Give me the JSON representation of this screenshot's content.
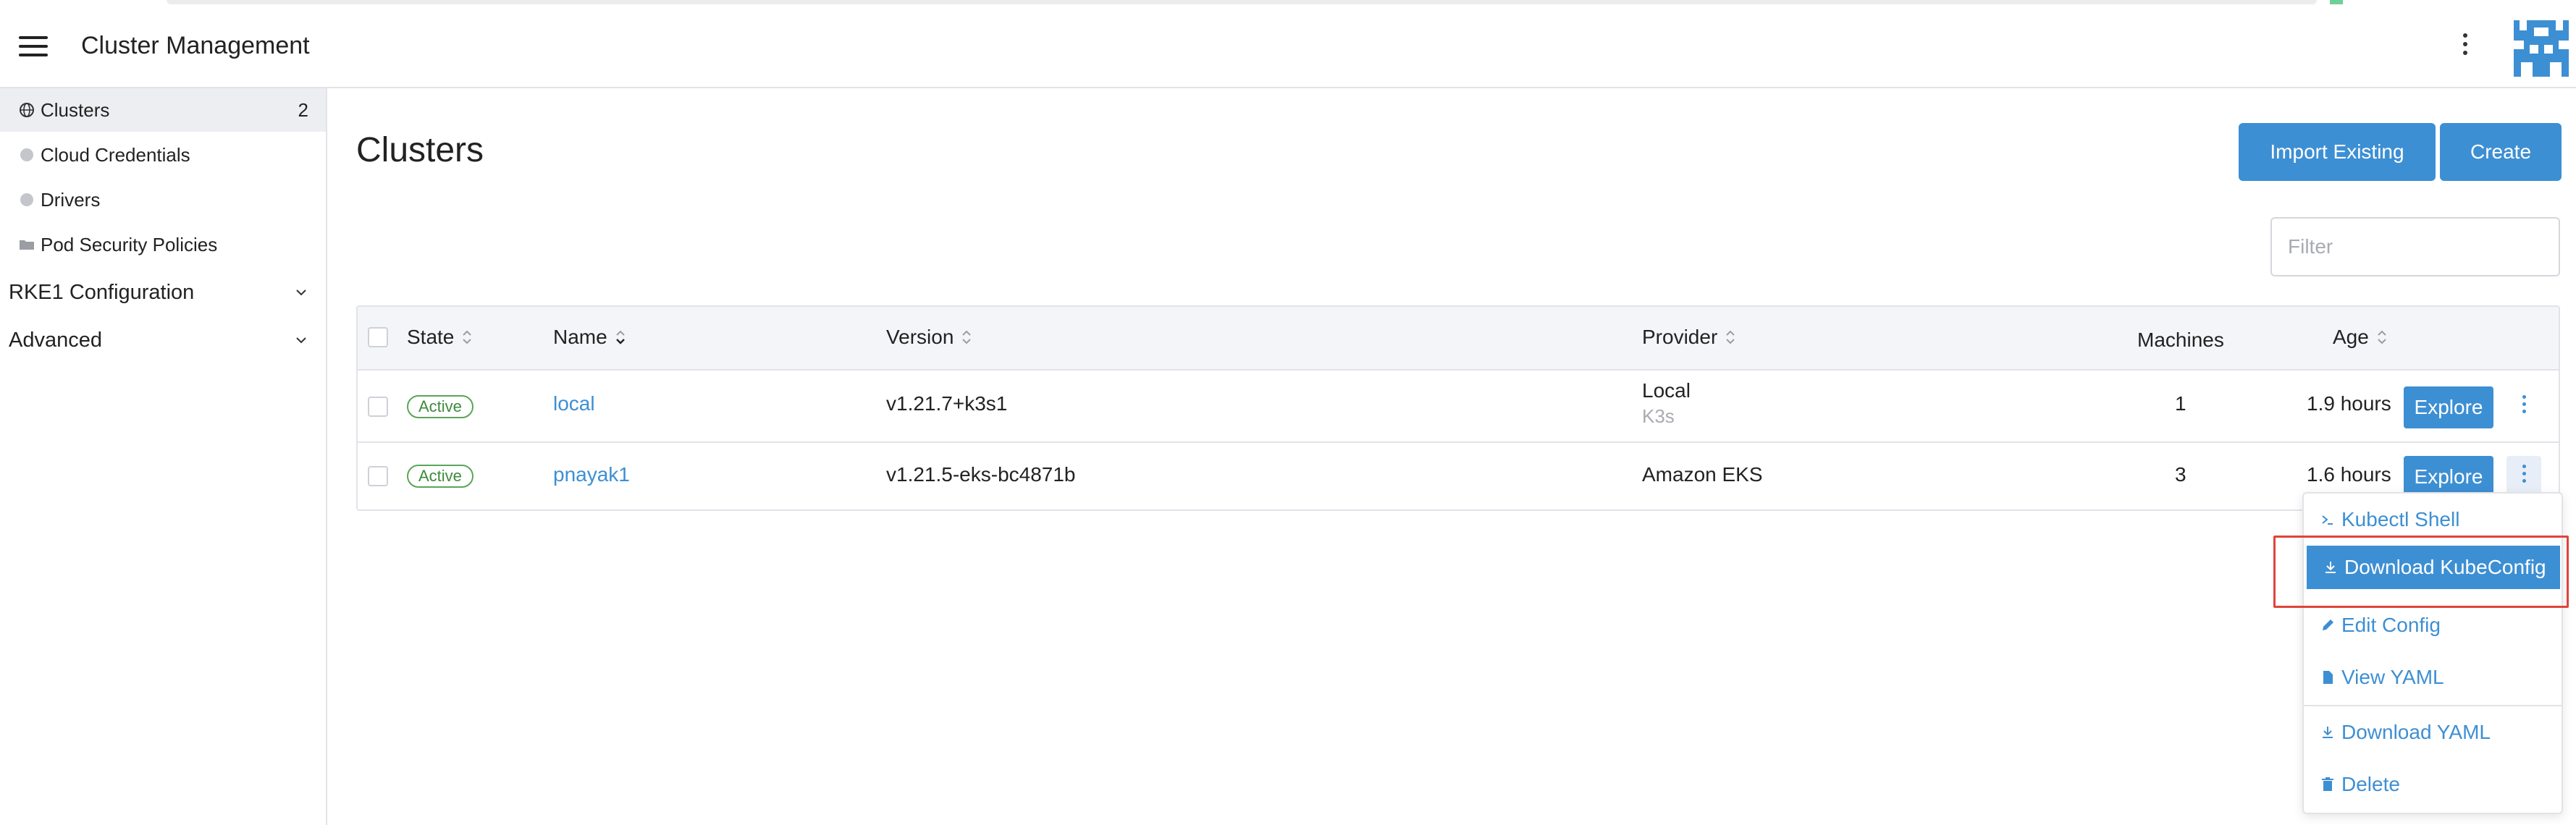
{
  "header": {
    "title": "Cluster Management"
  },
  "sidebar": {
    "items": [
      {
        "label": "Clusters",
        "count": "2"
      },
      {
        "label": "Cloud Credentials"
      },
      {
        "label": "Drivers"
      },
      {
        "label": "Pod Security Policies"
      }
    ],
    "groups": [
      {
        "label": "RKE1 Configuration"
      },
      {
        "label": "Advanced"
      }
    ]
  },
  "main": {
    "title": "Clusters",
    "import_label": "Import Existing",
    "create_label": "Create",
    "filter_placeholder": "Filter"
  },
  "table": {
    "columns": [
      "State",
      "Name",
      "Version",
      "Provider",
      "Machines",
      "Age"
    ],
    "rows": [
      {
        "state": "Active",
        "name": "local",
        "version": "v1.21.7+k3s1",
        "provider": "Local",
        "provider_sub": "K3s",
        "machines": "1",
        "age": "1.9 hours",
        "action": "Explore"
      },
      {
        "state": "Active",
        "name": "pnayak1",
        "version": "v1.21.5-eks-bc4871b",
        "provider": "Amazon EKS",
        "provider_sub": "",
        "machines": "3",
        "age": "1.6 hours",
        "action": "Explore"
      }
    ]
  },
  "menu": {
    "items": [
      {
        "label": "Kubectl Shell",
        "icon": "terminal-icon"
      },
      {
        "label": "Download KubeConfig",
        "icon": "download-icon"
      },
      {
        "label": "Edit Config",
        "icon": "pencil-icon"
      },
      {
        "label": "View YAML",
        "icon": "file-icon"
      },
      {
        "label": "Download YAML",
        "icon": "download-icon"
      },
      {
        "label": "Delete",
        "icon": "trash-icon"
      }
    ]
  },
  "colors": {
    "accent": "#3d8fd3",
    "active_badge": "#5aa55a",
    "highlight_box": "#e0443a"
  }
}
